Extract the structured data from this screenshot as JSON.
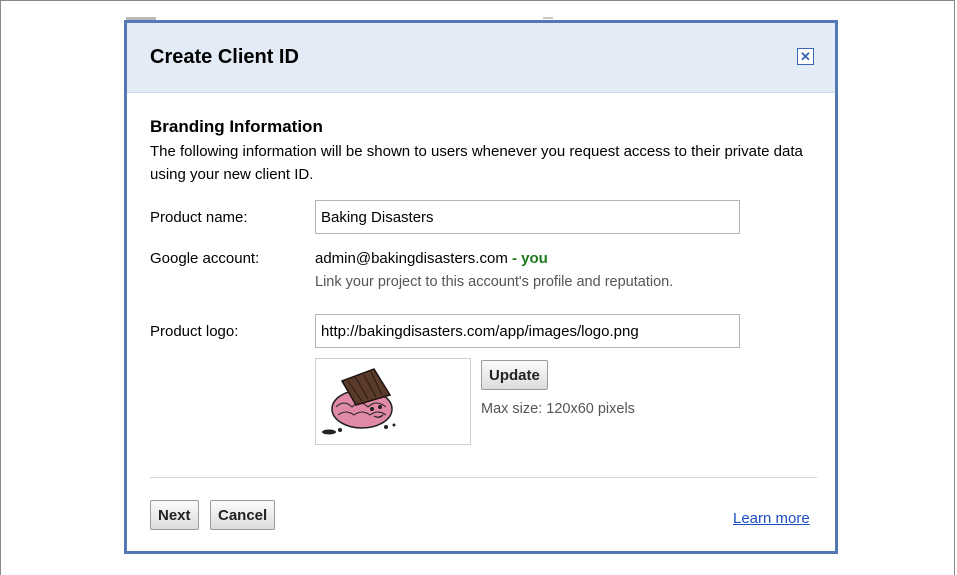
{
  "dialog": {
    "title": "Create Client ID",
    "close_glyph": "✕"
  },
  "branding": {
    "heading": "Branding Information",
    "description": "The following information will be shown to users whenever you request access to their private data using your new client ID."
  },
  "form": {
    "product_name_label": "Product name:",
    "product_name_value": "Baking Disasters",
    "google_account_label": "Google account:",
    "google_account_value": "admin@bakingdisasters.com",
    "you_badge": "- you",
    "account_help": "Link your project to this account's profile and reputation.",
    "product_logo_label": "Product logo:",
    "product_logo_value": "http://bakingdisasters.com/app/images/logo.png",
    "update_button": "Update",
    "max_size_note": "Max size: 120x60 pixels"
  },
  "footer": {
    "next_button": "Next",
    "cancel_button": "Cancel",
    "learn_more_link": "Learn more"
  },
  "icons": {
    "close": "close-icon",
    "logo_preview": "cupcake-logo-image"
  },
  "colors": {
    "dialog_border": "#5478b3",
    "titlebar_bg": "#e3ebf7",
    "you_green": "#1c7a1c",
    "link_blue": "#1d4fc2"
  }
}
